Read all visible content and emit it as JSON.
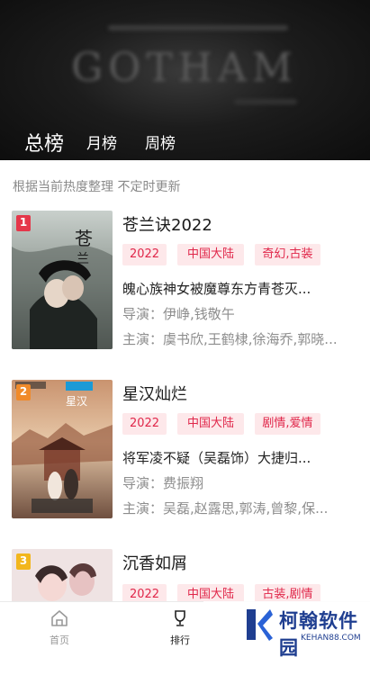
{
  "header": {
    "background_text": "GOTHAM",
    "tabs": [
      "总榜",
      "月榜",
      "周榜"
    ]
  },
  "note": "根据当前热度整理 不定时更新",
  "items": [
    {
      "rank": "1",
      "rank_color": "#e5374a",
      "title": "苍兰诀2022",
      "tags": [
        "2022",
        "中国大陆",
        "奇幻,古装"
      ],
      "desc": "魄心族神女被魔尊东方青苍灭...",
      "director": "导演：伊峥,钱敬午",
      "cast": "主演：虞书欣,王鹤棣,徐海乔,郭晓..."
    },
    {
      "rank": "2",
      "rank_color": "#f08a2a",
      "title": "星汉灿烂",
      "tags": [
        "2022",
        "中国大陆",
        "剧情,爱情"
      ],
      "desc": "将军凌不疑（吴磊饰）大捷归...",
      "director": "导演：费振翔",
      "cast": "主演：吴磊,赵露思,郭涛,曾黎,保..."
    },
    {
      "rank": "3",
      "rank_color": "#f2b61d",
      "title": "沉香如屑",
      "tags": [
        "2022",
        "中国大陆",
        "古装,剧情"
      ]
    }
  ],
  "bottom_nav": {
    "home": "首页",
    "rank": "排行"
  },
  "watermark": {
    "name": "柯翰软件园",
    "url": "KEHAN88.COM"
  },
  "colors": {
    "tag_bg": "#fde8ea",
    "tag_text": "#e0274a",
    "watermark_blue": "#1f3e90"
  }
}
